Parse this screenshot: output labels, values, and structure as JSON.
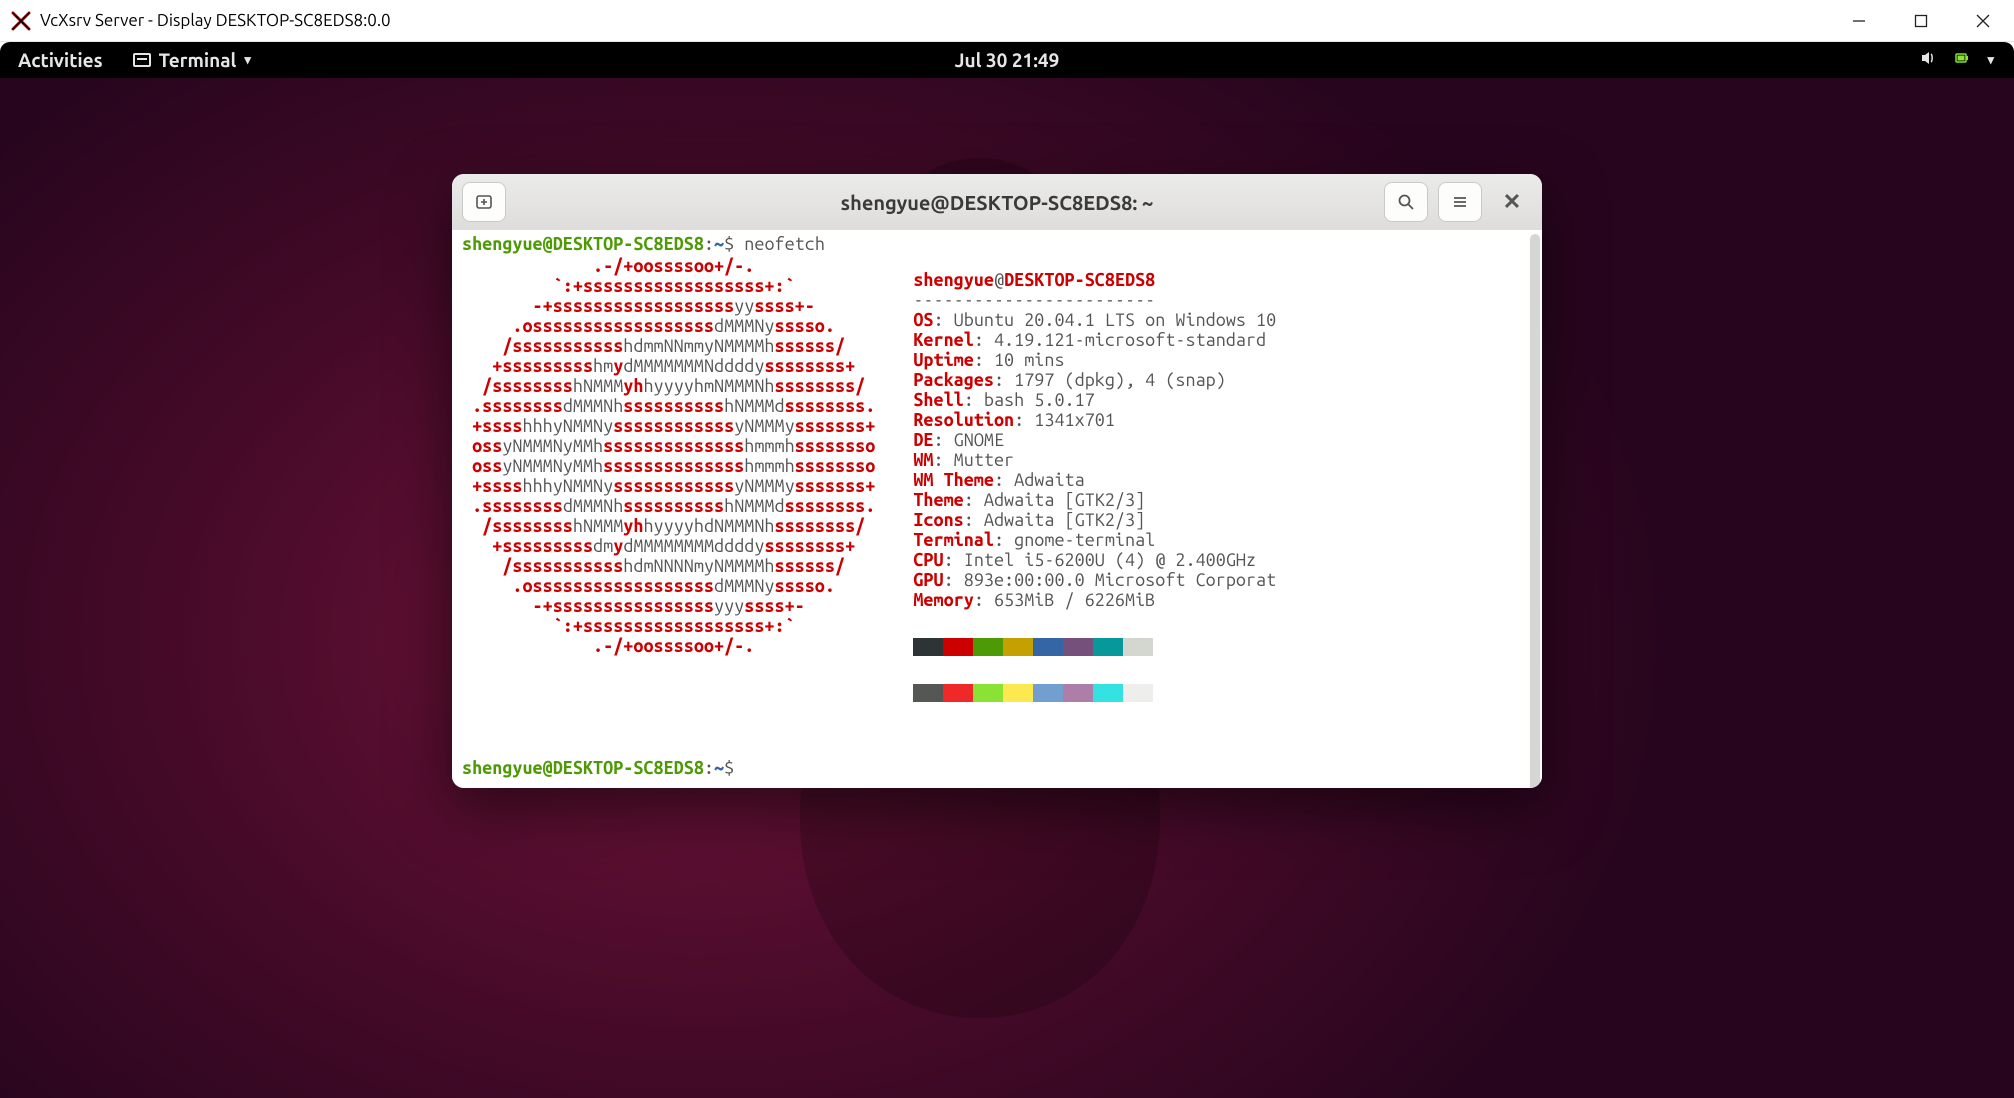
{
  "windows": {
    "title": "VcXsrv Server - Display DESKTOP-SC8EDS8:0.0"
  },
  "gnome": {
    "activities": "Activities",
    "app_label": "Terminal",
    "clock": "Jul 30  21:49"
  },
  "terminal": {
    "title": "shengyue@DESKTOP-SC8EDS8: ~",
    "prompt_user": "shengyue@DESKTOP-SC8EDS8",
    "prompt_sep": ":",
    "prompt_path": "~",
    "prompt_dollar": "$",
    "command": "neofetch"
  },
  "neofetch": {
    "header_user": "shengyue",
    "header_at": "@",
    "header_host": "DESKTOP-SC8EDS8",
    "divider": "------------------------",
    "rows": [
      {
        "label": "OS",
        "value": "Ubuntu 20.04.1 LTS on Windows 10"
      },
      {
        "label": "Kernel",
        "value": "4.19.121-microsoft-standard"
      },
      {
        "label": "Uptime",
        "value": "10 mins"
      },
      {
        "label": "Packages",
        "value": "1797 (dpkg), 4 (snap)"
      },
      {
        "label": "Shell",
        "value": "bash 5.0.17"
      },
      {
        "label": "Resolution",
        "value": "1341x701"
      },
      {
        "label": "DE",
        "value": "GNOME"
      },
      {
        "label": "WM",
        "value": "Mutter"
      },
      {
        "label": "WM Theme",
        "value": "Adwaita"
      },
      {
        "label": "Theme",
        "value": "Adwaita [GTK2/3]"
      },
      {
        "label": "Icons",
        "value": "Adwaita [GTK2/3]"
      },
      {
        "label": "Terminal",
        "value": "gnome-terminal"
      },
      {
        "label": "CPU",
        "value": "Intel i5-6200U (4) @ 2.400GHz"
      },
      {
        "label": "GPU",
        "value": "893e:00:00.0 Microsoft Corporat"
      },
      {
        "label": "Memory",
        "value": "653MiB / 6226MiB"
      }
    ],
    "logo_lines": [
      [
        {
          "c": "r",
          "t": "             .-/+oossssoo+/-."
        }
      ],
      [
        {
          "c": "r",
          "t": "         `:+ssssssssssssssssss+:`"
        }
      ],
      [
        {
          "c": "r",
          "t": "       -+ssssssssssssssssss"
        },
        {
          "c": "gr",
          "t": "yy"
        },
        {
          "c": "r",
          "t": "ssss+-"
        }
      ],
      [
        {
          "c": "r",
          "t": "     .ossssssssssssssssss"
        },
        {
          "c": "gr",
          "t": "dMMMNy"
        },
        {
          "c": "r",
          "t": "sssso."
        }
      ],
      [
        {
          "c": "r",
          "t": "    /sssssssssss"
        },
        {
          "c": "gr",
          "t": "hdmmNNmmyNMMMMh"
        },
        {
          "c": "r",
          "t": "ssssss/"
        }
      ],
      [
        {
          "c": "r",
          "t": "   +sssssssss"
        },
        {
          "c": "gr",
          "t": "hm"
        },
        {
          "c": "r",
          "t": "y"
        },
        {
          "c": "gr",
          "t": "dMMMMMMMNddddy"
        },
        {
          "c": "r",
          "t": "ssssssss+"
        }
      ],
      [
        {
          "c": "r",
          "t": "  /ssssssss"
        },
        {
          "c": "gr",
          "t": "hNMMM"
        },
        {
          "c": "r",
          "t": "yh"
        },
        {
          "c": "gr",
          "t": "hyyyyhmNMMMNh"
        },
        {
          "c": "r",
          "t": "ssssssss/"
        }
      ],
      [
        {
          "c": "r",
          "t": " .ssssssss"
        },
        {
          "c": "gr",
          "t": "dMMMNh"
        },
        {
          "c": "r",
          "t": "ssssssssss"
        },
        {
          "c": "gr",
          "t": "hNMMMd"
        },
        {
          "c": "r",
          "t": "ssssssss."
        }
      ],
      [
        {
          "c": "r",
          "t": " +ssss"
        },
        {
          "c": "gr",
          "t": "hhhyNMMNy"
        },
        {
          "c": "r",
          "t": "ssssssssssss"
        },
        {
          "c": "gr",
          "t": "yNMMMy"
        },
        {
          "c": "r",
          "t": "sssssss+"
        }
      ],
      [
        {
          "c": "r",
          "t": " oss"
        },
        {
          "c": "gr",
          "t": "yNMMMNyMMh"
        },
        {
          "c": "r",
          "t": "ssssssssssssss"
        },
        {
          "c": "gr",
          "t": "hmmmh"
        },
        {
          "c": "r",
          "t": "ssssssso"
        }
      ],
      [
        {
          "c": "r",
          "t": " oss"
        },
        {
          "c": "gr",
          "t": "yNMMMNyMMh"
        },
        {
          "c": "r",
          "t": "ssssssssssssss"
        },
        {
          "c": "gr",
          "t": "hmmmh"
        },
        {
          "c": "r",
          "t": "ssssssso"
        }
      ],
      [
        {
          "c": "r",
          "t": " +ssss"
        },
        {
          "c": "gr",
          "t": "hhhyNMMNy"
        },
        {
          "c": "r",
          "t": "ssssssssssss"
        },
        {
          "c": "gr",
          "t": "yNMMMy"
        },
        {
          "c": "r",
          "t": "sssssss+"
        }
      ],
      [
        {
          "c": "r",
          "t": " .ssssssss"
        },
        {
          "c": "gr",
          "t": "dMMMNh"
        },
        {
          "c": "r",
          "t": "ssssssssss"
        },
        {
          "c": "gr",
          "t": "hNMMMd"
        },
        {
          "c": "r",
          "t": "ssssssss."
        }
      ],
      [
        {
          "c": "r",
          "t": "  /ssssssss"
        },
        {
          "c": "gr",
          "t": "hNMMM"
        },
        {
          "c": "r",
          "t": "yh"
        },
        {
          "c": "gr",
          "t": "hyyyyhdNMMMNh"
        },
        {
          "c": "r",
          "t": "ssssssss/"
        }
      ],
      [
        {
          "c": "r",
          "t": "   +sssssssss"
        },
        {
          "c": "gr",
          "t": "dm"
        },
        {
          "c": "r",
          "t": "y"
        },
        {
          "c": "gr",
          "t": "dMMMMMMMMddddy"
        },
        {
          "c": "r",
          "t": "ssssssss+"
        }
      ],
      [
        {
          "c": "r",
          "t": "    /sssssssssss"
        },
        {
          "c": "gr",
          "t": "hdmNNNNmyNMMMMh"
        },
        {
          "c": "r",
          "t": "ssssss/"
        }
      ],
      [
        {
          "c": "r",
          "t": "     .ossssssssssssssssss"
        },
        {
          "c": "gr",
          "t": "dMMMNy"
        },
        {
          "c": "r",
          "t": "sssso."
        }
      ],
      [
        {
          "c": "r",
          "t": "       -+ssssssssssssssss"
        },
        {
          "c": "gr",
          "t": "yyy"
        },
        {
          "c": "r",
          "t": "ssss+-"
        }
      ],
      [
        {
          "c": "r",
          "t": "         `:+ssssssssssssssssss+:`"
        }
      ],
      [
        {
          "c": "r",
          "t": "             .-/+oossssoo+/-."
        }
      ]
    ],
    "swatches_dark": [
      "#2e3436",
      "#cc0000",
      "#4e9a06",
      "#c4a000",
      "#3465a4",
      "#75507b",
      "#06989a",
      "#d3d7cf"
    ],
    "swatches_light": [
      "#555753",
      "#ef2929",
      "#8ae234",
      "#fce94f",
      "#729fcf",
      "#ad7fa8",
      "#34e2e2",
      "#eeeeec"
    ]
  }
}
